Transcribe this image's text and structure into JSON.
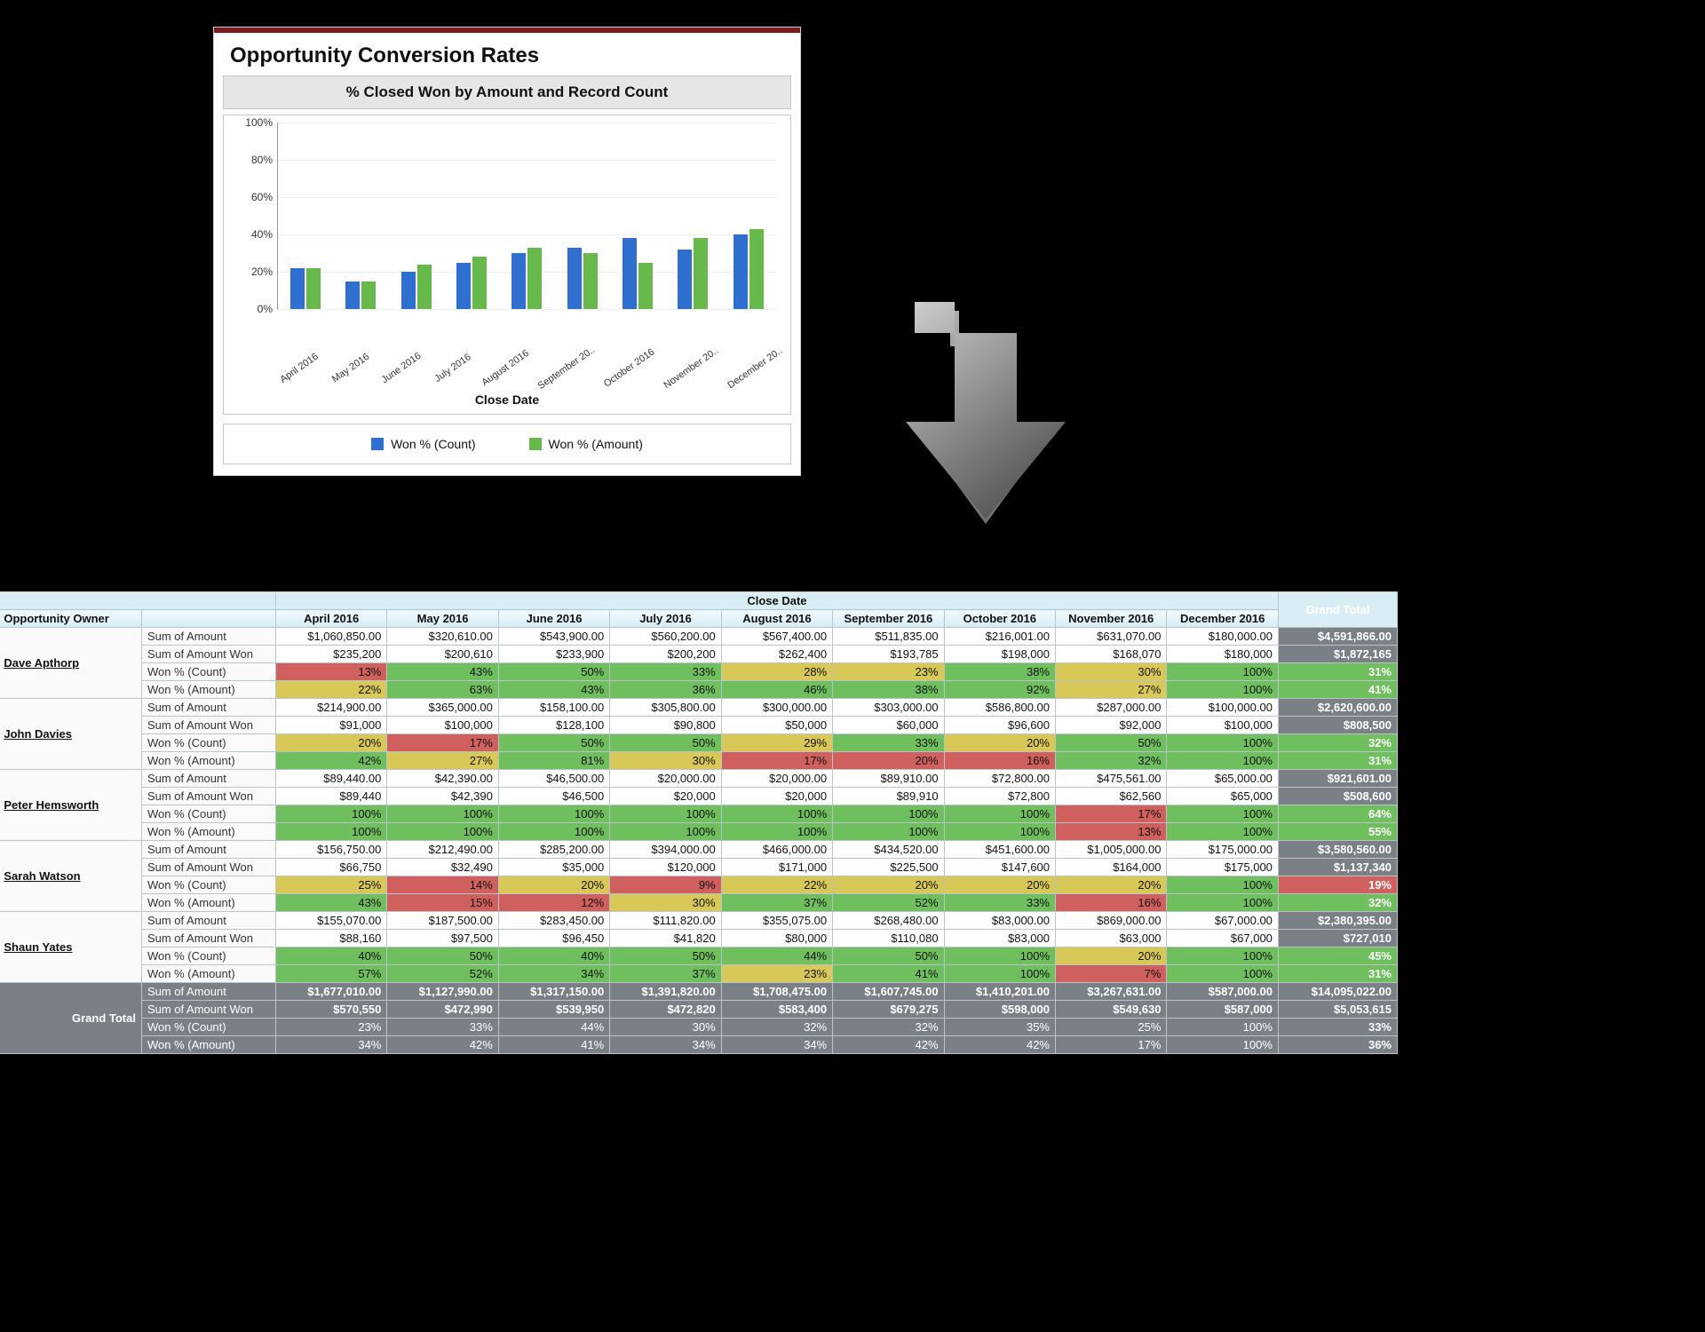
{
  "card": {
    "title": "Opportunity Conversion Rates",
    "chart_title": "% Closed Won by Amount and Record Count",
    "x_axis_label": "Close Date",
    "legend": {
      "a": "Won % (Count)",
      "b": "Won % (Amount)"
    }
  },
  "chart_data": {
    "type": "bar",
    "title": "% Closed Won by Amount and Record Count",
    "xlabel": "Close Date",
    "ylabel": "",
    "ylim": [
      0,
      100
    ],
    "yticks": [
      0,
      20,
      40,
      60,
      80,
      100
    ],
    "ytick_labels": [
      "0%",
      "20%",
      "40%",
      "60%",
      "80%",
      "100%"
    ],
    "categories": [
      "April 2016",
      "May 2016",
      "June 2016",
      "July 2016",
      "August 2016",
      "September 20..",
      "October 2016",
      "November 20..",
      "December 20.."
    ],
    "series": [
      {
        "name": "Won % (Count)",
        "color": "#2f6fd0",
        "values": [
          22,
          15,
          20,
          25,
          30,
          33,
          38,
          32,
          40
        ]
      },
      {
        "name": "Won % (Amount)",
        "color": "#67b94b",
        "values": [
          22,
          15,
          24,
          28,
          33,
          30,
          25,
          38,
          43
        ]
      }
    ],
    "legend_position": "bottom"
  },
  "table": {
    "close_date_header": "Close Date",
    "owner_header": "Opportunity Owner",
    "grand_total_header": "Grand Total",
    "months": [
      "April 2016",
      "May 2016",
      "June 2016",
      "July 2016",
      "August 2016",
      "September 2016",
      "October 2016",
      "November 2016",
      "December 2016"
    ],
    "metrics": [
      "Sum of Amount",
      "Sum of Amount Won",
      "Won % (Count)",
      "Won % (Amount)"
    ],
    "owners": [
      {
        "name": "Dave Apthorp",
        "rows": {
          "Sum of Amount": [
            "$1,060,850.00",
            "$320,610.00",
            "$543,900.00",
            "$560,200.00",
            "$567,400.00",
            "$511,835.00",
            "$216,001.00",
            "$631,070.00",
            "$180,000.00"
          ],
          "Sum of Amount Won": [
            "$235,200",
            "$200,610",
            "$233,900",
            "$200,200",
            "$262,400",
            "$193,785",
            "$198,000",
            "$168,070",
            "$180,000"
          ],
          "Won % (Count)": [
            {
              "v": "13%",
              "h": "r"
            },
            {
              "v": "43%",
              "h": "g"
            },
            {
              "v": "50%",
              "h": "g"
            },
            {
              "v": "33%",
              "h": "g"
            },
            {
              "v": "28%",
              "h": "y"
            },
            {
              "v": "23%",
              "h": "y"
            },
            {
              "v": "38%",
              "h": "g"
            },
            {
              "v": "30%",
              "h": "y"
            },
            {
              "v": "100%",
              "h": "g"
            }
          ],
          "Won % (Amount)": [
            {
              "v": "22%",
              "h": "y"
            },
            {
              "v": "63%",
              "h": "g"
            },
            {
              "v": "43%",
              "h": "g"
            },
            {
              "v": "36%",
              "h": "g"
            },
            {
              "v": "46%",
              "h": "g"
            },
            {
              "v": "38%",
              "h": "g"
            },
            {
              "v": "92%",
              "h": "g"
            },
            {
              "v": "27%",
              "h": "y"
            },
            {
              "v": "100%",
              "h": "g"
            }
          ]
        },
        "totals": [
          "$4,591,866.00",
          "$1,872,165",
          {
            "v": "31%",
            "h": "g"
          },
          {
            "v": "41%",
            "h": "g"
          }
        ]
      },
      {
        "name": "John Davies",
        "rows": {
          "Sum of Amount": [
            "$214,900.00",
            "$365,000.00",
            "$158,100.00",
            "$305,800.00",
            "$300,000.00",
            "$303,000.00",
            "$586,800.00",
            "$287,000.00",
            "$100,000.00"
          ],
          "Sum of Amount Won": [
            "$91,000",
            "$100,000",
            "$128,100",
            "$90,800",
            "$50,000",
            "$60,000",
            "$96,600",
            "$92,000",
            "$100,000"
          ],
          "Won % (Count)": [
            {
              "v": "20%",
              "h": "y"
            },
            {
              "v": "17%",
              "h": "r"
            },
            {
              "v": "50%",
              "h": "g"
            },
            {
              "v": "50%",
              "h": "g"
            },
            {
              "v": "29%",
              "h": "y"
            },
            {
              "v": "33%",
              "h": "g"
            },
            {
              "v": "20%",
              "h": "y"
            },
            {
              "v": "50%",
              "h": "g"
            },
            {
              "v": "100%",
              "h": "g"
            }
          ],
          "Won % (Amount)": [
            {
              "v": "42%",
              "h": "g"
            },
            {
              "v": "27%",
              "h": "y"
            },
            {
              "v": "81%",
              "h": "g"
            },
            {
              "v": "30%",
              "h": "y"
            },
            {
              "v": "17%",
              "h": "r"
            },
            {
              "v": "20%",
              "h": "r"
            },
            {
              "v": "16%",
              "h": "r"
            },
            {
              "v": "32%",
              "h": "g"
            },
            {
              "v": "100%",
              "h": "g"
            }
          ]
        },
        "totals": [
          "$2,620,600.00",
          "$808,500",
          {
            "v": "32%",
            "h": "g"
          },
          {
            "v": "31%",
            "h": "g"
          }
        ]
      },
      {
        "name": "Peter Hemsworth",
        "rows": {
          "Sum of Amount": [
            "$89,440.00",
            "$42,390.00",
            "$46,500.00",
            "$20,000.00",
            "$20,000.00",
            "$89,910.00",
            "$72,800.00",
            "$475,561.00",
            "$65,000.00"
          ],
          "Sum of Amount Won": [
            "$89,440",
            "$42,390",
            "$46,500",
            "$20,000",
            "$20,000",
            "$89,910",
            "$72,800",
            "$62,560",
            "$65,000"
          ],
          "Won % (Count)": [
            {
              "v": "100%",
              "h": "g"
            },
            {
              "v": "100%",
              "h": "g"
            },
            {
              "v": "100%",
              "h": "g"
            },
            {
              "v": "100%",
              "h": "g"
            },
            {
              "v": "100%",
              "h": "g"
            },
            {
              "v": "100%",
              "h": "g"
            },
            {
              "v": "100%",
              "h": "g"
            },
            {
              "v": "17%",
              "h": "r"
            },
            {
              "v": "100%",
              "h": "g"
            }
          ],
          "Won % (Amount)": [
            {
              "v": "100%",
              "h": "g"
            },
            {
              "v": "100%",
              "h": "g"
            },
            {
              "v": "100%",
              "h": "g"
            },
            {
              "v": "100%",
              "h": "g"
            },
            {
              "v": "100%",
              "h": "g"
            },
            {
              "v": "100%",
              "h": "g"
            },
            {
              "v": "100%",
              "h": "g"
            },
            {
              "v": "13%",
              "h": "r"
            },
            {
              "v": "100%",
              "h": "g"
            }
          ]
        },
        "totals": [
          "$921,601.00",
          "$508,600",
          {
            "v": "64%",
            "h": "g"
          },
          {
            "v": "55%",
            "h": "g"
          }
        ]
      },
      {
        "name": "Sarah Watson",
        "rows": {
          "Sum of Amount": [
            "$156,750.00",
            "$212,490.00",
            "$285,200.00",
            "$394,000.00",
            "$466,000.00",
            "$434,520.00",
            "$451,600.00",
            "$1,005,000.00",
            "$175,000.00"
          ],
          "Sum of Amount Won": [
            "$66,750",
            "$32,490",
            "$35,000",
            "$120,000",
            "$171,000",
            "$225,500",
            "$147,600",
            "$164,000",
            "$175,000"
          ],
          "Won % (Count)": [
            {
              "v": "25%",
              "h": "y"
            },
            {
              "v": "14%",
              "h": "r"
            },
            {
              "v": "20%",
              "h": "y"
            },
            {
              "v": "9%",
              "h": "r"
            },
            {
              "v": "22%",
              "h": "y"
            },
            {
              "v": "20%",
              "h": "y"
            },
            {
              "v": "20%",
              "h": "y"
            },
            {
              "v": "20%",
              "h": "y"
            },
            {
              "v": "100%",
              "h": "g"
            }
          ],
          "Won % (Amount)": [
            {
              "v": "43%",
              "h": "g"
            },
            {
              "v": "15%",
              "h": "r"
            },
            {
              "v": "12%",
              "h": "r"
            },
            {
              "v": "30%",
              "h": "y"
            },
            {
              "v": "37%",
              "h": "g"
            },
            {
              "v": "52%",
              "h": "g"
            },
            {
              "v": "33%",
              "h": "g"
            },
            {
              "v": "16%",
              "h": "r"
            },
            {
              "v": "100%",
              "h": "g"
            }
          ]
        },
        "totals": [
          "$3,580,560.00",
          "$1,137,340",
          {
            "v": "19%",
            "h": "r"
          },
          {
            "v": "32%",
            "h": "g"
          }
        ]
      },
      {
        "name": "Shaun Yates",
        "rows": {
          "Sum of Amount": [
            "$155,070.00",
            "$187,500.00",
            "$283,450.00",
            "$111,820.00",
            "$355,075.00",
            "$268,480.00",
            "$83,000.00",
            "$869,000.00",
            "$67,000.00"
          ],
          "Sum of Amount Won": [
            "$88,160",
            "$97,500",
            "$96,450",
            "$41,820",
            "$80,000",
            "$110,080",
            "$83,000",
            "$63,000",
            "$67,000"
          ],
          "Won % (Count)": [
            {
              "v": "40%",
              "h": "g"
            },
            {
              "v": "50%",
              "h": "g"
            },
            {
              "v": "40%",
              "h": "g"
            },
            {
              "v": "50%",
              "h": "g"
            },
            {
              "v": "44%",
              "h": "g"
            },
            {
              "v": "50%",
              "h": "g"
            },
            {
              "v": "100%",
              "h": "g"
            },
            {
              "v": "20%",
              "h": "y"
            },
            {
              "v": "100%",
              "h": "g"
            }
          ],
          "Won % (Amount)": [
            {
              "v": "57%",
              "h": "g"
            },
            {
              "v": "52%",
              "h": "g"
            },
            {
              "v": "34%",
              "h": "g"
            },
            {
              "v": "37%",
              "h": "g"
            },
            {
              "v": "23%",
              "h": "y"
            },
            {
              "v": "41%",
              "h": "g"
            },
            {
              "v": "100%",
              "h": "g"
            },
            {
              "v": "7%",
              "h": "r"
            },
            {
              "v": "100%",
              "h": "g"
            }
          ]
        },
        "totals": [
          "$2,380,395.00",
          "$727,010",
          {
            "v": "45%",
            "h": "g"
          },
          {
            "v": "31%",
            "h": "g"
          }
        ]
      }
    ],
    "grand_total_row": {
      "label": "Grand Total",
      "rows": {
        "Sum of Amount": [
          "$1,677,010.00",
          "$1,127,990.00",
          "$1,317,150.00",
          "$1,391,820.00",
          "$1,708,475.00",
          "$1,607,745.00",
          "$1,410,201.00",
          "$3,267,631.00",
          "$587,000.00"
        ],
        "Sum of Amount Won": [
          "$570,550",
          "$472,990",
          "$539,950",
          "$472,820",
          "$583,400",
          "$679,275",
          "$598,000",
          "$549,630",
          "$587,000"
        ],
        "Won % (Count)": [
          {
            "v": "23%",
            "h": "y"
          },
          {
            "v": "33%",
            "h": "g"
          },
          {
            "v": "44%",
            "h": "g"
          },
          {
            "v": "30%",
            "h": "y"
          },
          {
            "v": "32%",
            "h": "g"
          },
          {
            "v": "32%",
            "h": "g"
          },
          {
            "v": "35%",
            "h": "g"
          },
          {
            "v": "25%",
            "h": "y"
          },
          {
            "v": "100%",
            "h": "g"
          }
        ],
        "Won % (Amount)": [
          {
            "v": "34%",
            "h": "g"
          },
          {
            "v": "42%",
            "h": "g"
          },
          {
            "v": "41%",
            "h": "g"
          },
          {
            "v": "34%",
            "h": "g"
          },
          {
            "v": "34%",
            "h": "g"
          },
          {
            "v": "42%",
            "h": "g"
          },
          {
            "v": "42%",
            "h": "g"
          },
          {
            "v": "17%",
            "h": "r"
          },
          {
            "v": "100%",
            "h": "g"
          }
        ]
      },
      "totals": [
        "$14,095,022.00",
        "$5,053,615",
        {
          "v": "33%",
          "h": "g"
        },
        {
          "v": "36%",
          "h": "g"
        }
      ]
    }
  }
}
